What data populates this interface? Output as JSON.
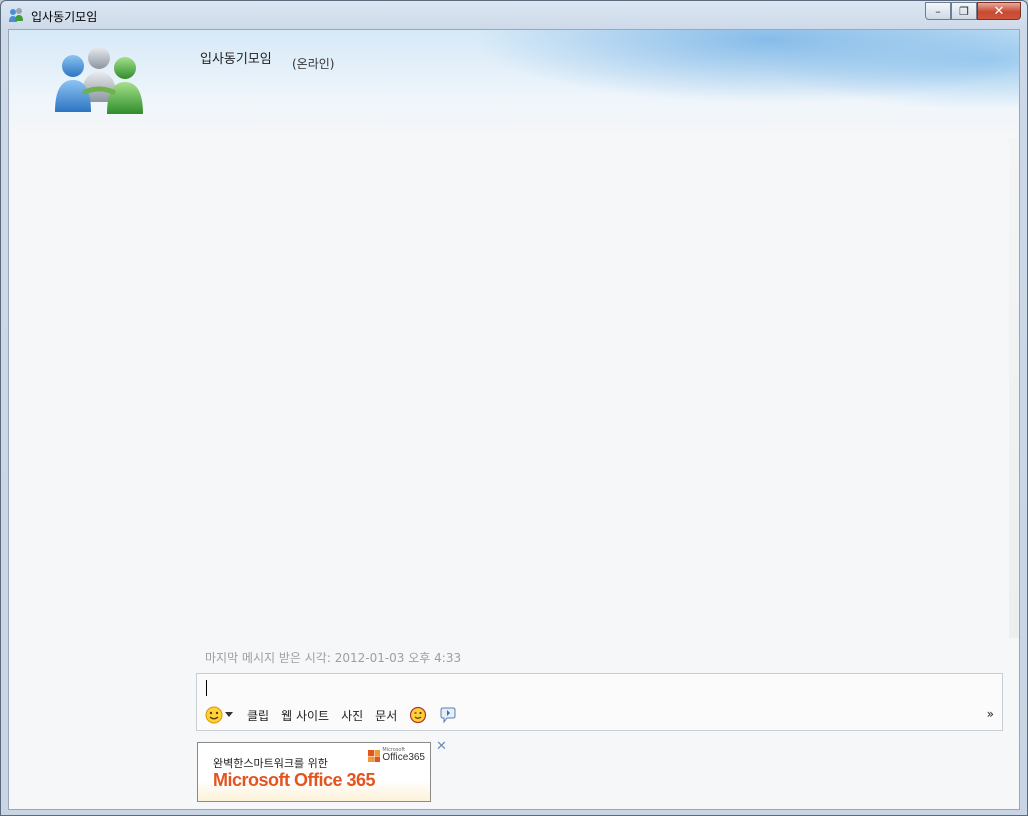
{
  "window": {
    "title": "입사동기모임",
    "minimize_label": "–",
    "restore_label": "❐",
    "close_label": "✕"
  },
  "contact": {
    "name": "입사동기모임",
    "status": "(온라인)"
  },
  "conversation": {
    "last_message": "마지막 메시지 받은 시각: 2012-01-03 오후 4:33"
  },
  "compose": {
    "value": "",
    "toolbar": {
      "clip_label": "클립",
      "website_label": "웹 사이트",
      "photo_label": "사진",
      "document_label": "문서",
      "more_label": "»"
    }
  },
  "ad": {
    "tagline": "완벽한스마트워크를 위한",
    "brand": "Microsoft Office 365",
    "logo_small": "Microsoft",
    "logo_text": "Office365",
    "close_label": "✕"
  },
  "colors": {
    "accent": "#1e6fc0",
    "ad_brand": "#e3541f",
    "close_button": "#c74b33"
  }
}
